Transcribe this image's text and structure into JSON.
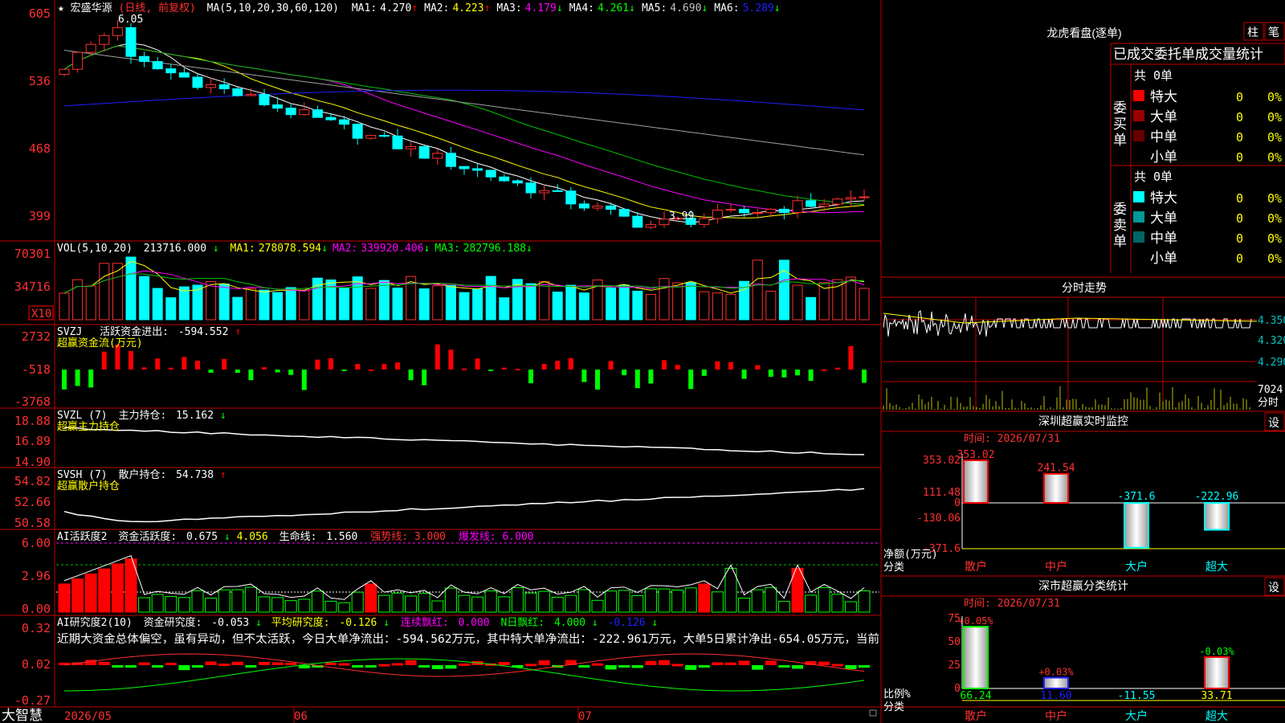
{
  "stock": {
    "star": "★",
    "name": "宏盛华源",
    "period": "(日线, 前复权)",
    "ma_label": "MA(5,10,20,30,60,120)",
    "ma_values": [
      {
        "k": "MA1:",
        "v": "4.270",
        "arrow": "↑",
        "color": "#ffffff"
      },
      {
        "k": "MA2:",
        "v": "4.223",
        "arrow": "↑",
        "color": "#ffff00"
      },
      {
        "k": "MA3:",
        "v": "4.179",
        "arrow": "↓",
        "color": "#ff00ff"
      },
      {
        "k": "MA4:",
        "v": "4.261",
        "arrow": "↓",
        "color": "#00ff00"
      },
      {
        "k": "MA5:",
        "v": "4.690",
        "arrow": "↓",
        "color": "#c0c0c0"
      },
      {
        "k": "MA6:",
        "v": "5.289",
        "arrow": "↓",
        "color": "#2020ff"
      }
    ],
    "high_mark": "6.05",
    "low_mark": "3.99"
  },
  "price_axis": [
    "605",
    "536",
    "468",
    "399"
  ],
  "vol": {
    "title": "VOL(5,10,20)",
    "val": "213716.000",
    "arr": "↓",
    "ma": [
      {
        "k": "MA1:",
        "v": "278078.594",
        "arrow": "↓",
        "color": "#ffff00"
      },
      {
        "k": "MA2:",
        "v": "339920.406",
        "arrow": "↓",
        "color": "#ff00ff"
      },
      {
        "k": "MA3:",
        "v": "282796.188",
        "arrow": "↓",
        "color": "#00ff00"
      }
    ],
    "axis": [
      "70301",
      "34716"
    ],
    "unit": "X10"
  },
  "svzj": {
    "title": "SVZJ",
    "label": "活跃资金进出:",
    "val": "-594.552",
    "arrow": "↑",
    "sub": "超赢资金流(万元)",
    "axis": [
      "2732",
      "-518",
      "-3768"
    ]
  },
  "svzl": {
    "title": "SVZL (7)",
    "label": "主力持仓:",
    "val": "15.162",
    "arrow": "↓",
    "sub": "超赢主力持仓",
    "axis": [
      "18.88",
      "16.89",
      "14.90"
    ]
  },
  "svsh": {
    "title": "SVSH (7)",
    "label": "散户持仓:",
    "val": "54.738",
    "arrow": "↑",
    "sub": "超赢散户持仓",
    "axis": [
      "54.82",
      "52.66",
      "50.58"
    ]
  },
  "ai1": {
    "title": "AI活跃度2",
    "label": "资金活跃度:",
    "v1": "0.675",
    "a1": "↓",
    "v2": "4.056",
    "label2": "生命线:",
    "v3": "1.560",
    "qs": "强势线:",
    "qsv": "3.000",
    "bf": "爆发线:",
    "bfv": "6.000",
    "axis": [
      "6.00",
      "2.96",
      "0.00"
    ]
  },
  "ai2": {
    "title": "AI研究度2(10)",
    "l1": "资金研究度:",
    "v1": "-0.053",
    "a1": "↓",
    "l2": "平均研究度:",
    "v2": "-0.126",
    "a2": "↓",
    "l3": "连续飘红:",
    "v3": "0.000",
    "l4": "N日飘红:",
    "v4": "4.000",
    "a4": "↓",
    "v5": "-0.126",
    "a5": "↓",
    "text": "近期大资金总体偏空，虽有异动，但不太活跃，今日大单净流出：-594.562万元，其中特大单净流出：-222.961万元，大单5日累计净出-654.05万元，当前",
    "axis": [
      "0.32",
      "0.02",
      "-0.27"
    ]
  },
  "bottom": {
    "brand": "大智慧",
    "dates": [
      "2026/05",
      "06",
      "07"
    ]
  },
  "lhb": {
    "title": "龙虎看盘(逐单)",
    "btn1": "柱",
    "btn2": "笔",
    "header": "已成交委托单成交量统计",
    "buy": {
      "side": "委买单",
      "total": "共 0单",
      "rows": [
        {
          "name": "特大",
          "n": "0",
          "p": "0%",
          "c": "#ff0000"
        },
        {
          "name": "大单",
          "n": "0",
          "p": "0%",
          "c": "#990000"
        },
        {
          "name": "中单",
          "n": "0",
          "p": "0%",
          "c": "#660000"
        },
        {
          "name": "小单",
          "n": "0",
          "p": "0%",
          "c": ""
        }
      ]
    },
    "sell": {
      "side": "委卖单",
      "total": "共 0单",
      "rows": [
        {
          "name": "特大",
          "n": "0",
          "p": "0%",
          "c": "#00ffff"
        },
        {
          "name": "大单",
          "n": "0",
          "p": "0%",
          "c": "#009999"
        },
        {
          "name": "中单",
          "n": "0",
          "p": "0%",
          "c": "#006666"
        },
        {
          "name": "小单",
          "n": "0",
          "p": "0%",
          "c": ""
        }
      ]
    }
  },
  "fenshi": {
    "title": "分时走势",
    "axis": [
      "4.350",
      "4.320",
      "4.290"
    ],
    "vol": "7024",
    "unit": "分时"
  },
  "sz_monitor": {
    "title": "深圳超赢实时监控",
    "btn": "设",
    "time": "时间: 2026/07/31",
    "axis": [
      "353.02",
      "111.48",
      "0",
      "-130.06",
      "-371.6"
    ],
    "bars": [
      {
        "cat": "散户",
        "v": "353.02"
      },
      {
        "cat": "中户",
        "v": "241.54"
      },
      {
        "cat": "大户",
        "v": "-371.6"
      },
      {
        "cat": "超大",
        "v": "-222.96"
      }
    ],
    "ylabel": "净额(万元)",
    "xlabel": "分类"
  },
  "sz_class": {
    "title": "深市超赢分类统计",
    "btn": "设",
    "time": "时间: 2026/07/31",
    "axis": [
      "75",
      "50",
      "25",
      "0"
    ],
    "bars": [
      {
        "cat": "散户",
        "top": "+0.05%",
        "bot": "66.24"
      },
      {
        "cat": "中户",
        "top": "+0.03%",
        "bot": "11.60"
      },
      {
        "cat": "大户",
        "top": "",
        "bot": "-11.55"
      },
      {
        "cat": "超大",
        "top": "-0.03%",
        "bot": "33.71"
      }
    ],
    "ylabel": "比例%",
    "xlabel": "分类"
  },
  "chart_data": {
    "type": "candlestick",
    "title": "宏盛华源 (日线, 前复权)",
    "ylim": [
      3.99,
      6.05
    ],
    "x": [
      "2026/05",
      "06",
      "07"
    ],
    "last_close": 4.27
  }
}
